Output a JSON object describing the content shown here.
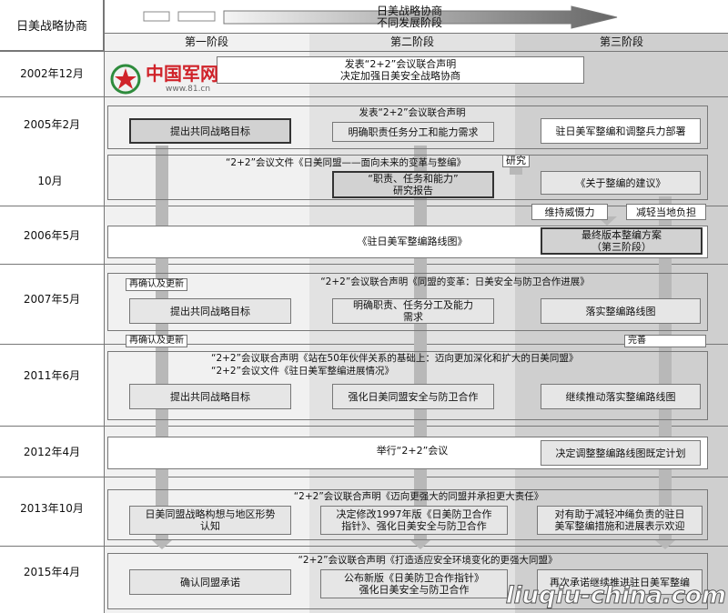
{
  "header": {
    "corner": "日美战略协商",
    "arrow_title": "日美战略协商",
    "arrow_subtitle": "不同发展阶段",
    "phases": [
      "第一阶段",
      "第二阶段",
      "第三阶段"
    ]
  },
  "watermark": {
    "logo": "中国军网",
    "url": "www.81.cn",
    "site": "liuqiu-china.com"
  },
  "rows": {
    "r2002": {
      "date": "2002年12月",
      "statement": "发表“2+2”会议联合声明\n决定加强日美安全战略协商"
    },
    "r2005": {
      "date": "2005年2月",
      "statement": "发表“2+2”会议联合声明",
      "col1": "提出共同战略目标",
      "col2": "明确职责任务分工和能力需求",
      "col3": "驻日美军整编和调整兵力部署"
    },
    "r2005b": {
      "date": "10月",
      "doc": "“2+2”会议文件《日美同盟——面向未来的变革与整编》",
      "study": "研究",
      "col2": "“职责、任务和能力”\n研究报告",
      "col3": "《关于整编的建议》",
      "deter": "维持威慑力",
      "burden": "减轻当地负担"
    },
    "r2006": {
      "date": "2006年5月",
      "roadmap": "《驻日美军整编路线图》",
      "final": "最终版本整编方案\n（第三阶段）"
    },
    "r2007": {
      "date": "2007年5月",
      "reconfirm": "再确认及更新",
      "statement": "“2+2”会议联合声明《同盟的变革：日美安全与防卫合作进展》",
      "col1": "提出共同战略目标",
      "col2": "明确职责、任务分工及能力\n需求",
      "col3": "落实整编路线图",
      "reconfirm2": "再确认及更新",
      "improve": "完善"
    },
    "r2011": {
      "date": "2011年6月",
      "statement1": "“2+2”会议联合声明《站在50年伙伴关系的基础上：迈向更加深化和扩大的日美同盟》",
      "statement2": "“2+2”会议文件《驻日美军整编进展情况》",
      "col1": "提出共同战略目标",
      "col2": "强化日美同盟安全与防卫合作",
      "col3": "继续推动落实整编路线图"
    },
    "r2012": {
      "date": "2012年4月",
      "meeting": "举行“2+2”会议",
      "col3": "决定调整整编路线图既定计划"
    },
    "r2013": {
      "date": "2013年10月",
      "statement": "“2+2”会议联合声明《迈向更强大的同盟并承担更大责任》",
      "col1": "日美同盟战略构想与地区形势\n认知",
      "col2": "决定修改1997年版《日美防卫合作\n指针》、强化日美安全与防卫合作",
      "col3": "对有助于减轻冲绳负责的驻日\n美军整编措施和进展表示欢迎"
    },
    "r2015": {
      "date": "2015年4月",
      "statement": "“2+2”会议联合声明《打造适应安全环境变化的更强大同盟》",
      "col1": "确认同盟承诺",
      "col2": "公布新版《日美防卫合作指针》\n强化日美安全与防卫合作",
      "col3": "再次承诺继续推进驻日美军整编"
    }
  },
  "colors": {
    "col1": "#f1f1f1",
    "col2": "#e2e2e2",
    "col3": "#cfcfcf",
    "logo_red": "#d0232a",
    "logo_green": "#2e8b3c"
  }
}
